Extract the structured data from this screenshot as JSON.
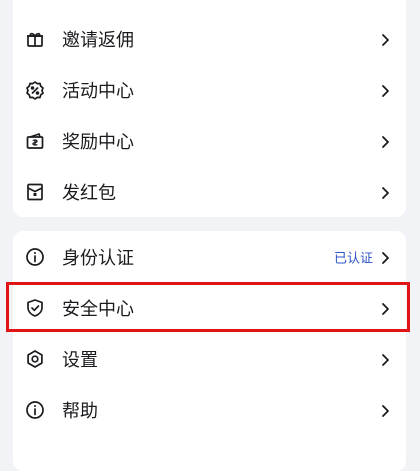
{
  "menu_group_1": {
    "items": [
      {
        "label": "邀请返佣",
        "icon": "gift-icon"
      },
      {
        "label": "活动中心",
        "icon": "activity-badge-icon"
      },
      {
        "label": "奖励中心",
        "icon": "reward-wallet-icon"
      },
      {
        "label": "发红包",
        "icon": "red-envelope-icon"
      }
    ]
  },
  "menu_group_2": {
    "items": [
      {
        "label": "身份认证",
        "icon": "info-icon",
        "status": "已认证"
      },
      {
        "label": "安全中心",
        "icon": "shield-check-icon",
        "highlighted": true
      },
      {
        "label": "设置",
        "icon": "gear-icon"
      },
      {
        "label": "帮助",
        "icon": "info-icon"
      }
    ]
  },
  "colors": {
    "background": "#f2f3f7",
    "card": "#ffffff",
    "text": "#1b1b1f",
    "status": "#2f55c8",
    "highlight_border": "#e01414"
  }
}
